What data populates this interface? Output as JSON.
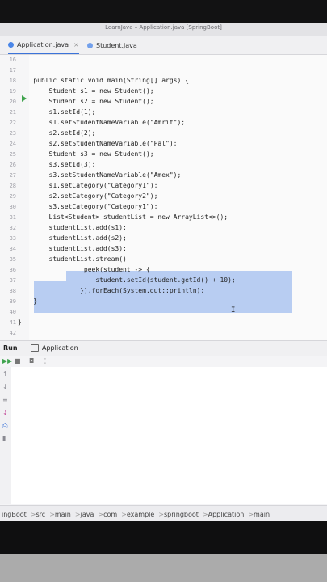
{
  "window": {
    "title": "LearnJava – Application.java [SpringBoot]"
  },
  "tabs": [
    {
      "label": "Application.java",
      "close": "×"
    },
    {
      "label": "Student.java"
    }
  ],
  "code": [
    {
      "n": "16",
      "t": ""
    },
    {
      "n": "17",
      "t": ""
    },
    {
      "n": "18",
      "t": "    public static void main(String[] args) {"
    },
    {
      "n": "19",
      "t": "        Student s1 = new Student();"
    },
    {
      "n": "20",
      "t": "        Student s2 = new Student();"
    },
    {
      "n": "21",
      "t": "        s1.setId(1);"
    },
    {
      "n": "22",
      "t": "        s1.setStudentNameVariable(\"Amrit\");"
    },
    {
      "n": "23",
      "t": "        s2.setId(2);"
    },
    {
      "n": "24",
      "t": "        s2.setStudentNameVariable(\"Pal\");"
    },
    {
      "n": "25",
      "t": "        Student s3 = new Student();"
    },
    {
      "n": "26",
      "t": "        s3.setId(3);"
    },
    {
      "n": "27",
      "t": "        s3.setStudentNameVariable(\"Amex\");"
    },
    {
      "n": "28",
      "t": "        s1.setCategory(\"Category1\");"
    },
    {
      "n": "29",
      "t": "        s2.setCategory(\"Category2\");"
    },
    {
      "n": "30",
      "t": "        s3.setCategory(\"Category1\");"
    },
    {
      "n": "31",
      "t": "        List<Student> studentList = new ArrayList<>();"
    },
    {
      "n": "32",
      "t": "        studentList.add(s1);"
    },
    {
      "n": "33",
      "t": "        studentList.add(s2);"
    },
    {
      "n": "34",
      "t": "        studentList.add(s3);"
    },
    {
      "n": "35",
      "t": "        studentList.stream()"
    },
    {
      "n": "36",
      "t": "                .peek(student -> {"
    },
    {
      "n": "37",
      "t": "                    student.setId(student.getId() + 10);"
    },
    {
      "n": "38",
      "t": "                }).forEach(System.out::println);"
    },
    {
      "n": "39",
      "t": "    }"
    },
    {
      "n": "40",
      "t": ""
    },
    {
      "n": "41",
      "t": "}"
    },
    {
      "n": "42",
      "t": ""
    }
  ],
  "run_panel": {
    "label": "Run",
    "tab": "Application"
  },
  "status": {
    "path": [
      "ingBoot",
      "src",
      "main",
      "java",
      "com",
      "example",
      "springboot",
      "Application",
      "main"
    ],
    "sep": ">"
  }
}
